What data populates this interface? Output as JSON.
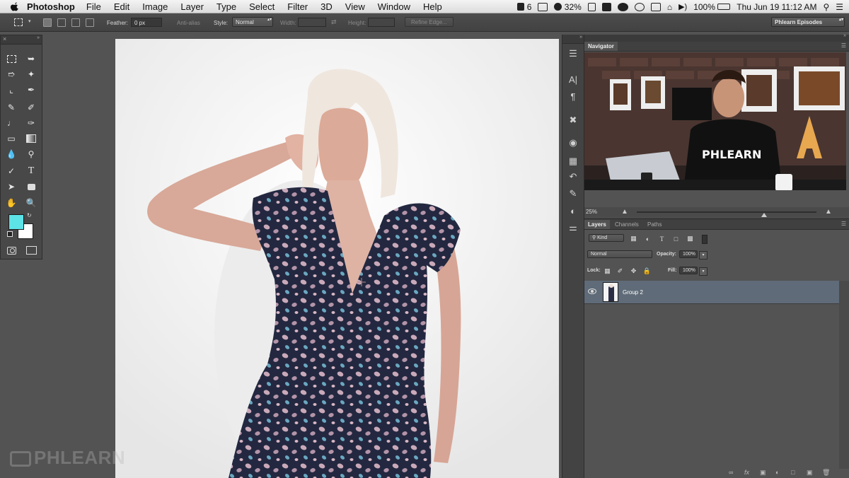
{
  "menubar": {
    "app_name": "Photoshop",
    "menus": [
      "File",
      "Edit",
      "Image",
      "Layer",
      "Type",
      "Select",
      "Filter",
      "3D",
      "View",
      "Window",
      "Help"
    ],
    "status": {
      "adobe_count": "6",
      "battery_meter": "32%",
      "battery": "100%",
      "datetime": "Thu Jun 19  11:12 AM"
    }
  },
  "options": {
    "feather_label": "Feather:",
    "feather_value": "0 px",
    "antialias_label": "Anti-alias",
    "style_label": "Style:",
    "style_value": "Normal",
    "width_label": "Width:",
    "height_label": "Height:",
    "refine_edge": "Refine Edge...",
    "workspace": "Phlearn Episodes"
  },
  "tools": {
    "foreground_color": "#5de2e6",
    "background_color": "#ffffff"
  },
  "canvas": {
    "watermark": "PHLEARN"
  },
  "navigator": {
    "tab": "Navigator",
    "zoom": "25%"
  },
  "layers": {
    "tabs": [
      "Layers",
      "Channels",
      "Paths"
    ],
    "filter_kind": "Kind",
    "blend_mode": "Normal",
    "opacity_label": "Opacity:",
    "opacity_value": "100%",
    "lock_label": "Lock:",
    "fill_label": "Fill:",
    "fill_value": "100%",
    "items": [
      {
        "name": "Group 2"
      }
    ]
  }
}
